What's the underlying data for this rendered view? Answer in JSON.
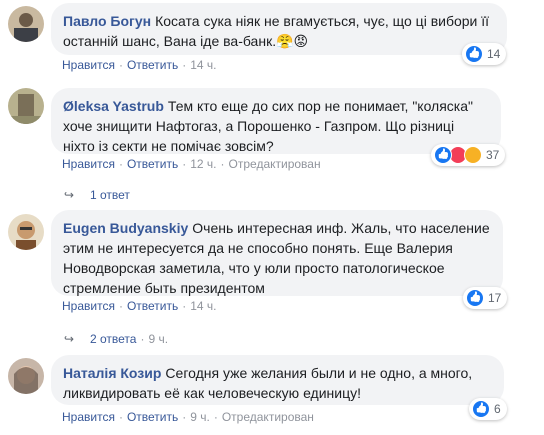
{
  "comments": [
    {
      "author": "Павло Богун",
      "text": "Косата сука ніяк не вгамується, чує, що ці вибори її останній шанс, Вана іде ва-банк.",
      "emoji_after": "😤😡",
      "actions": {
        "like": "Нравится",
        "reply": "Ответить",
        "time": "14 ч."
      },
      "reactions": {
        "count": "14",
        "icons": [
          "like-icon"
        ]
      }
    },
    {
      "author": "Øleksa Yastrub",
      "text": "Тем кто еще до сих пор не понимает, \"коляска\" хоче знищити Нафтогаз, а Порошенко - Газпром. Що різниці ніхто із секти не помічає зовсім?",
      "actions": {
        "like": "Нравится",
        "reply": "Ответить",
        "time": "12 ч.",
        "edited": "Отредактирован"
      },
      "reactions": {
        "count": "37",
        "icons": [
          "like-icon",
          "love-icon",
          "haha-icon"
        ]
      },
      "replies": {
        "label": "1 ответ"
      }
    },
    {
      "author": "Eugen Budyanskiy",
      "text": "Очень интересная инф. Жаль, что население этим не интересуется да не способно понять. Еще Валерия Новодворская заметила, что у юли просто патологическое стремление быть президентом",
      "actions": {
        "like": "Нравится",
        "reply": "Ответить",
        "time": "14 ч."
      },
      "reactions": {
        "count": "17",
        "icons": [
          "like-icon"
        ]
      },
      "replies": {
        "label": "2 ответа",
        "time": "9 ч."
      }
    },
    {
      "author": "Наталія Козир",
      "text": "Сегодня уже желания были и не одно, а много, ликвидировать её как человеческую единицу!",
      "actions": {
        "like": "Нравится",
        "reply": "Ответить",
        "time": "9 ч.",
        "edited": "Отредактирован"
      },
      "reactions": {
        "count": "6",
        "icons": [
          "like-icon"
        ]
      }
    }
  ],
  "colors": {
    "author": "#385898",
    "bubble": "#f2f3f5",
    "like": "#1877f2",
    "love": "#f33e58",
    "haha": "#f7b125"
  }
}
